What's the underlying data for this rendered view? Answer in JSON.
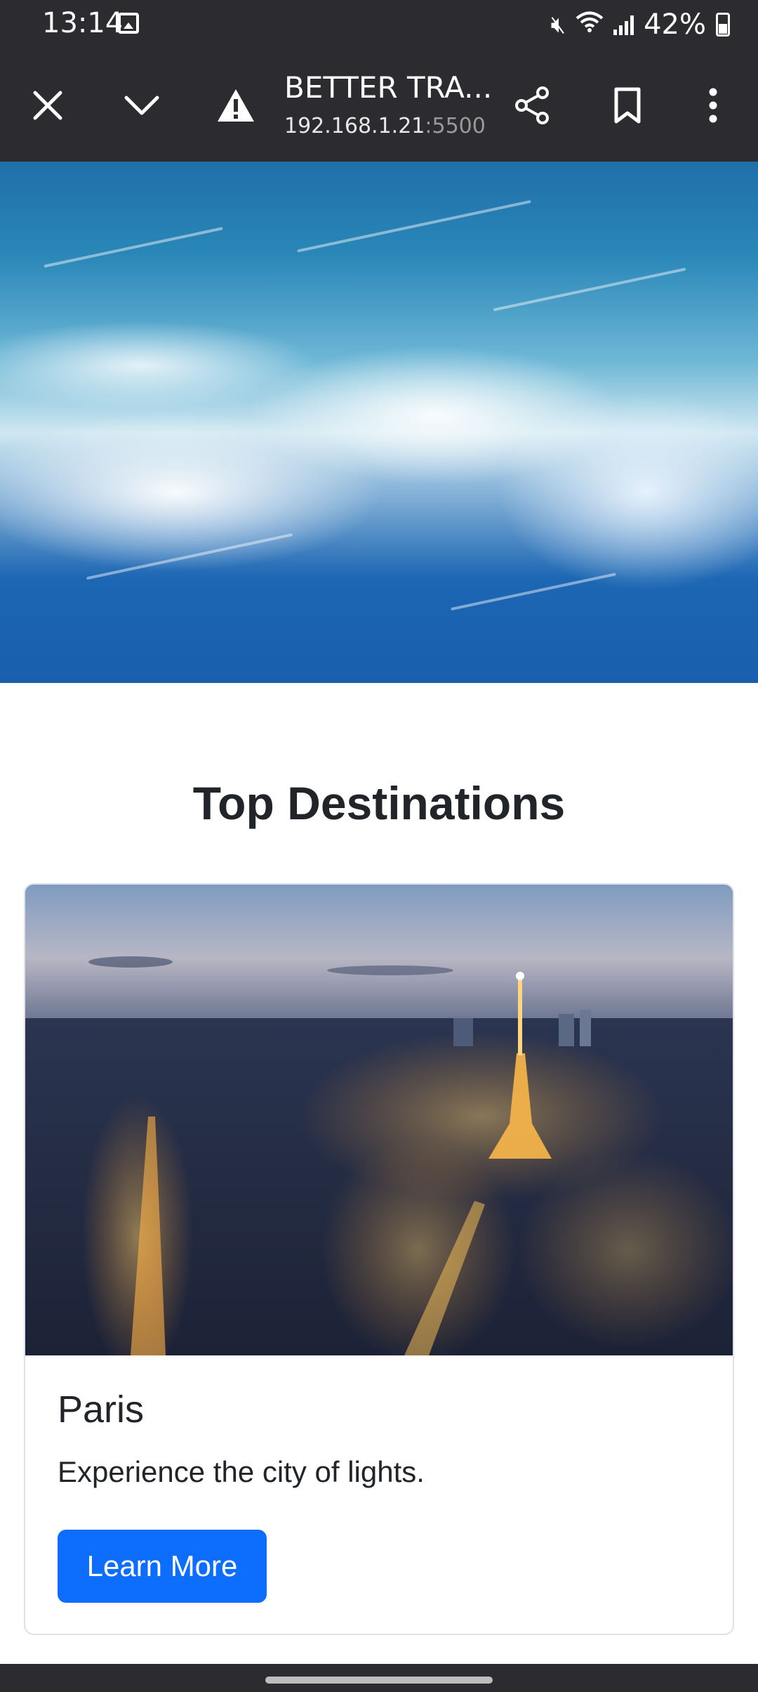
{
  "status_bar": {
    "time": "13:14",
    "battery": "42%",
    "icons": [
      "image-icon",
      "mute-icon",
      "wifi-icon",
      "signal-icon",
      "battery-icon"
    ]
  },
  "browser": {
    "title": "BETTER TRA...",
    "url_host": "192.168.1.21",
    "url_port": ":5500",
    "icons": [
      "close-icon",
      "chevron-down-icon",
      "warning-icon",
      "share-icon",
      "bookmark-icon",
      "more-vert-icon"
    ]
  },
  "page": {
    "section_title": "Top Destinations",
    "card": {
      "title": "Paris",
      "text": "Experience the city of lights.",
      "button_label": "Learn More"
    }
  },
  "colors": {
    "chrome_bg": "#2b2b30",
    "primary_button": "#0d6efd",
    "text": "#212529"
  }
}
